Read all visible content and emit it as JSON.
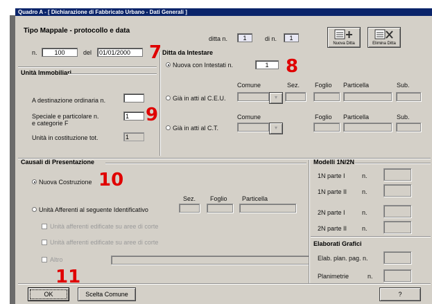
{
  "window": {
    "title": "Quadro A - [ Dichiarazione di Fabbricato Urbano - Dati Generali ]"
  },
  "tipo_mappale": {
    "heading": "Tipo Mappale - protocollo e data",
    "n_label": "n.",
    "n_value": "100",
    "del_label": "del",
    "del_value": "01/01/2000",
    "ditta_label": "ditta n.",
    "ditta_value": "1",
    "di_label": "di n.",
    "di_value": "1",
    "nuova_ditta_label": "Nuova Ditta",
    "elimina_ditta_label": "Elimina Ditta"
  },
  "ditta": {
    "heading": "Ditta da Intestare",
    "nuova_label": "Nuova con Intestati  n.",
    "nuova_value": "1",
    "ceu_label": "Già in atti al C.E.U.",
    "ct_label": "Già in atti al C.T.",
    "comune_label": "Comune",
    "sez_label": "Sez.",
    "foglio_label": "Foglio",
    "particella_label": "Particella",
    "sub_label": "Sub."
  },
  "unita": {
    "heading": "Unità Immobiliari",
    "ordinaria_label": "A destinazione ordinaria  n.",
    "speciale_label_1": "Speciale e particolare   n.",
    "speciale_label_2": "e categorie F",
    "speciale_value": "1",
    "costruzione_label": "Unità in costituzione    tot.",
    "costruzione_value": "1"
  },
  "causali": {
    "heading": "Causali di Presentazione",
    "nuova_costruzione": "Nuova Costruzione",
    "afferenti_label": "Unità Afferenti al seguente Identificativo",
    "sez_label": "Sez.",
    "foglio_label": "Foglio",
    "particella_label": "Particella",
    "check1": "Unità afferenti edificate su aree di corte",
    "check2": "Unità afferenti edificate su aree di corte",
    "check3": "Altro"
  },
  "modelli": {
    "heading": "Modelli 1N/2N",
    "row1": "1N parte I",
    "row2": "1N parte II",
    "row3": "2N parte I",
    "row4": "2N parte II",
    "n_label": "n."
  },
  "elaborati": {
    "heading": "Elaborati Grafici",
    "row1": "Elab. plan. pag. n.",
    "row2": "Planimetrie",
    "n_label": "n."
  },
  "buttons": {
    "ok": "OK",
    "scelta_comune": "Scelta Comune",
    "help": "?"
  },
  "annotations": {
    "a7": "7",
    "a8": "8",
    "a9": "9",
    "a10": "10",
    "a11": "11"
  },
  "colors": {
    "face": "#d4d0c8",
    "title_bar": "#0a246a",
    "annotation": "#e00000"
  }
}
